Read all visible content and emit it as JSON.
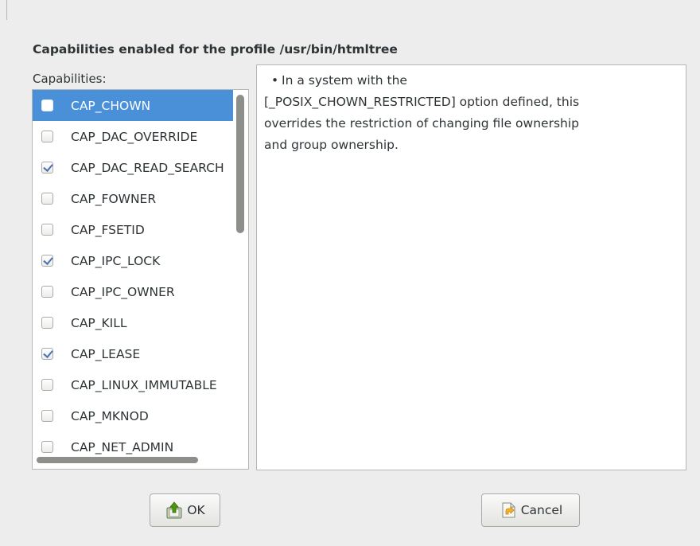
{
  "dialog": {
    "title": "Capabilities enabled for the profile /usr/bin/htmltree",
    "capabilities_label": "Capabilities:"
  },
  "capabilities": [
    {
      "name": "CAP_CHOWN",
      "checked": false,
      "selected": true
    },
    {
      "name": "CAP_DAC_OVERRIDE",
      "checked": false,
      "selected": false
    },
    {
      "name": "CAP_DAC_READ_SEARCH",
      "checked": true,
      "selected": false
    },
    {
      "name": "CAP_FOWNER",
      "checked": false,
      "selected": false
    },
    {
      "name": "CAP_FSETID",
      "checked": false,
      "selected": false
    },
    {
      "name": "CAP_IPC_LOCK",
      "checked": true,
      "selected": false
    },
    {
      "name": "CAP_IPC_OWNER",
      "checked": false,
      "selected": false
    },
    {
      "name": "CAP_KILL",
      "checked": false,
      "selected": false
    },
    {
      "name": "CAP_LEASE",
      "checked": true,
      "selected": false
    },
    {
      "name": "CAP_LINUX_IMMUTABLE",
      "checked": false,
      "selected": false
    },
    {
      "name": "CAP_MKNOD",
      "checked": false,
      "selected": false
    },
    {
      "name": "CAP_NET_ADMIN",
      "checked": false,
      "selected": false
    }
  ],
  "description": {
    "bullet": "•",
    "line1": "In a system with the",
    "line2": "[_POSIX_CHOWN_RESTRICTED] option defined, this",
    "line3": "overrides the restriction of changing file ownership",
    "line4": "and group ownership."
  },
  "buttons": {
    "ok_label": "OK",
    "ok_icon": "ok-icon",
    "cancel_label": "Cancel",
    "cancel_icon": "cancel-icon"
  },
  "colors": {
    "selection": "#4a90d9",
    "window_bg": "#ededed"
  }
}
